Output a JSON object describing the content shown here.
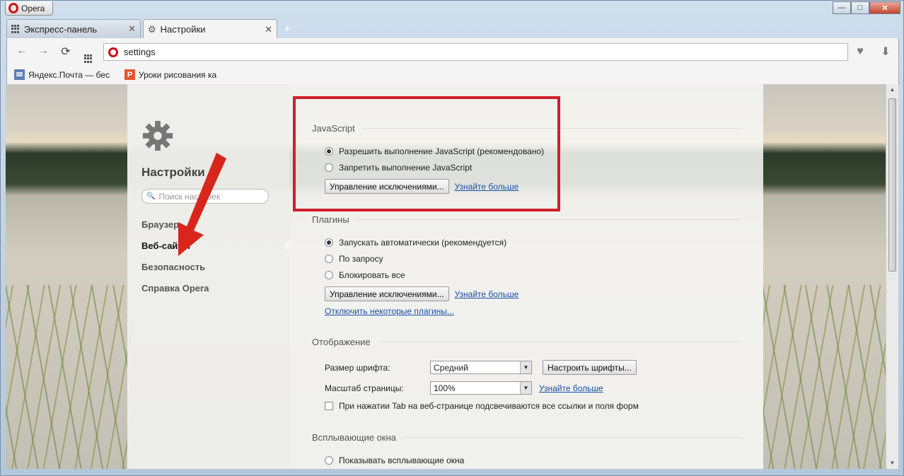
{
  "window": {
    "app_button": "Opera",
    "min": "—",
    "max": "□",
    "close": "✕"
  },
  "tabs": [
    {
      "label": "Экспресс-панель",
      "close": "✕"
    },
    {
      "label": "Настройки",
      "close": "✕"
    }
  ],
  "new_tab": "+",
  "nav": {
    "back": "←",
    "forward": "→",
    "reload": "⟳",
    "address": "settings",
    "heart": "♥",
    "download": "⬇"
  },
  "bookmarks": [
    {
      "label": "Яндекс.Почта — бес",
      "color": "#5a7fb3",
      "glyph": "✉"
    },
    {
      "label": "Уроки рисования ка",
      "color": "#e4572e",
      "glyph": "P"
    }
  ],
  "sidebar": {
    "title": "Настройки",
    "search_placeholder": "Поиск настроек",
    "search_icon": "🔍",
    "items": [
      "Браузер",
      "Веб-сайты",
      "Безопасность",
      "Справка Opera"
    ],
    "active_index": 1
  },
  "javascript": {
    "heading": "JavaScript",
    "allow": "Разрешить выполнение JavaScript (рекомендовано)",
    "deny": "Запретить выполнение JavaScript",
    "manage": "Управление исключениями...",
    "learn": "Узнайте больше"
  },
  "plugins": {
    "heading": "Плагины",
    "auto": "Запускать автоматически (рекомендуется)",
    "on_demand": "По запросу",
    "block": "Блокировать все",
    "manage": "Управление исключениями...",
    "learn": "Узнайте больше",
    "disable": "Отключить некоторые плагины..."
  },
  "display": {
    "heading": "Отображение",
    "font_size_label": "Размер шрифта:",
    "font_size_value": "Средний",
    "fonts_button": "Настроить шрифты...",
    "zoom_label": "Масштаб страницы:",
    "zoom_value": "100%",
    "learn": "Узнайте больше",
    "tab_highlight": "При нажатии Tab на веб-странице подсвечиваются все ссылки и поля форм"
  },
  "popups": {
    "heading": "Всплывающие окна",
    "show": "Показывать всплывающие окна"
  },
  "colors": {
    "highlight": "#cf1f2a",
    "arrow": "#d8261c",
    "link": "#1a4fa8",
    "opera_red": "#cc0f16"
  }
}
